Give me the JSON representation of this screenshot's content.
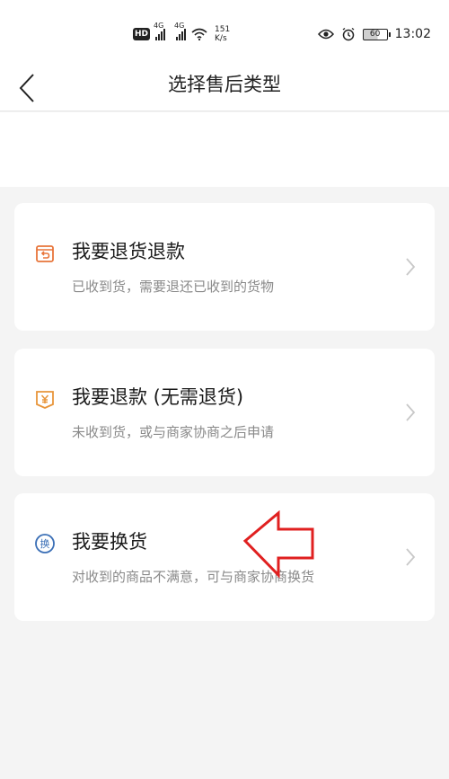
{
  "status_bar": {
    "hd": "HD",
    "signal_1_gen": "4G",
    "signal_2_gen": "4G",
    "speed_value": "151",
    "speed_unit": "K/s",
    "battery": "60",
    "time": "13:02"
  },
  "header": {
    "title": "选择售后类型"
  },
  "options": [
    {
      "title": "我要退货退款",
      "description": "已收到货，需要退还已收到的货物",
      "icon": "return-box-icon",
      "icon_color": "#e8753a"
    },
    {
      "title": "我要退款 (无需退货)",
      "description": "未收到货，或与商家协商之后申请",
      "icon": "yen-refund-icon",
      "icon_color": "#e8953a"
    },
    {
      "title": "我要换货",
      "description": "对收到的商品不满意，可与商家协商换货",
      "icon": "exchange-icon",
      "icon_color": "#3b6fb6"
    }
  ],
  "colors": {
    "annotation_arrow": "#e02020",
    "background": "#f4f4f4"
  }
}
